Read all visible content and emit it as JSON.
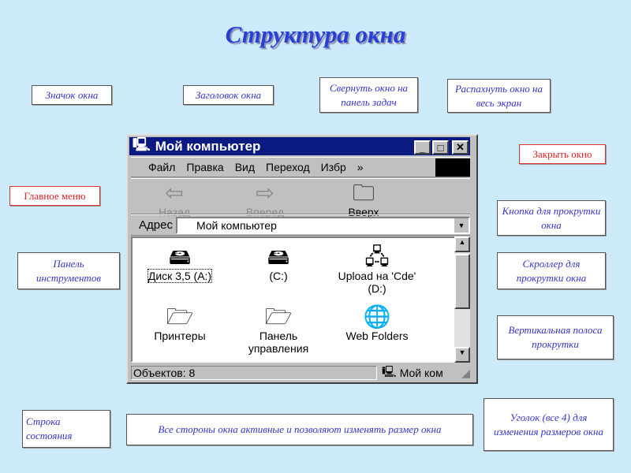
{
  "slide_title": "Структура окна",
  "callouts": {
    "icon": "Значок окна",
    "title": "Заголовок окна",
    "minimize": "Свернуть окно на панель задач",
    "maximize": "Распахнуть окно на весь экран",
    "close": "Закрыть окно",
    "menu": "Главное меню",
    "scroll_button": "Кнопка для прокрутки окна",
    "toolbar": "Панель инструментов",
    "scroller": "Скроллер для прокрутки окна",
    "vscroll": "Вертикальная полоса прокрутки",
    "statusbar": "Строка состояния",
    "sides": "Все стороны окна активные и позволяют изменять размер окна",
    "corner": "Уголок (все 4) для изменения размеров окна"
  },
  "window": {
    "title": "Мой компьютер",
    "menu": [
      "Файл",
      "Правка",
      "Вид",
      "Переход",
      "Избр"
    ],
    "toolbar": {
      "back": "Назад",
      "forward": "Вперед",
      "up": "Вверх"
    },
    "address_label": "Адрес",
    "address_value": "Мой компьютер",
    "items": [
      "Диск 3,5 (A:)",
      "(C:)",
      "Upload на 'Cde' (D:)",
      "Принтеры",
      "Панель управления",
      "Web Folders"
    ],
    "status_left": "Объектов: 8",
    "status_right": "Мой ком"
  }
}
